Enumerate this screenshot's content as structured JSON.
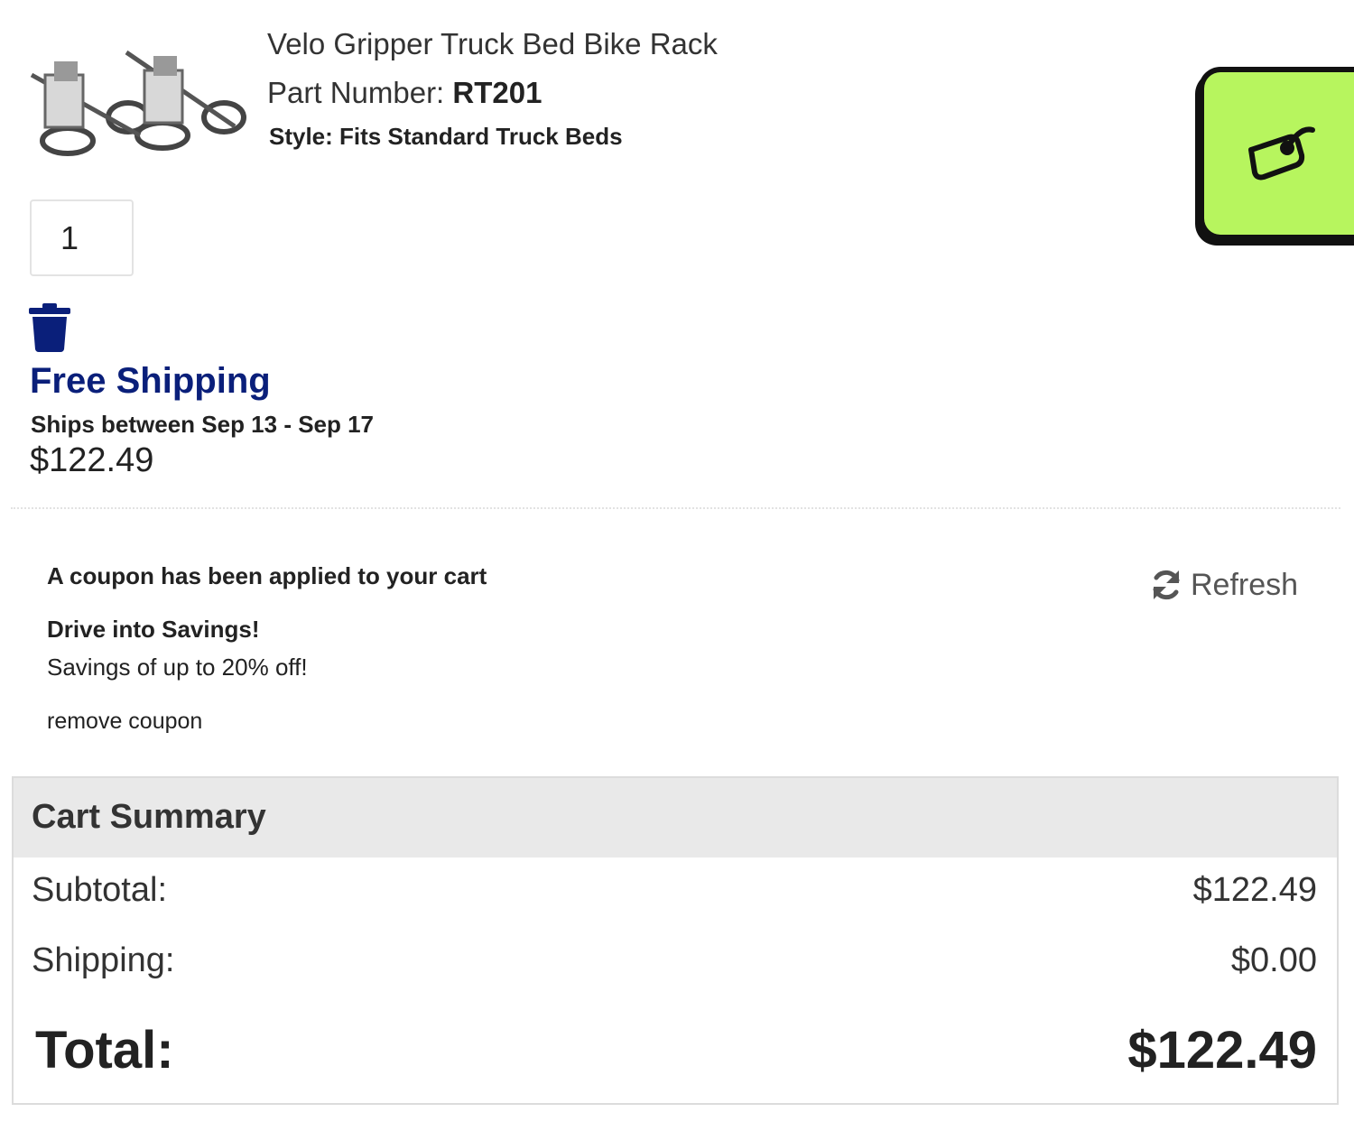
{
  "product": {
    "title": "Velo Gripper Truck Bed Bike Rack",
    "part_label": "Part Number: ",
    "part_number": "RT201",
    "style": "Style: Fits Standard Truck Beds",
    "quantity": "1",
    "shipping_label": "Free Shipping",
    "ships_between": "Ships between Sep 13 - Sep 17",
    "price": "$122.49",
    "image_icon": "bike-rack-product-image"
  },
  "coupon_tab": {
    "icon": "coupon-tag-icon",
    "color": "#b7f55e"
  },
  "coupon": {
    "applied_message": "A coupon has been applied to your cart",
    "promo_title": "Drive into Savings!",
    "promo_desc": "Savings of up to 20% off!",
    "remove_label": "remove coupon",
    "refresh_label": "Refresh",
    "refresh_icon": "refresh-icon"
  },
  "summary": {
    "title": "Cart Summary",
    "subtotal_label": "Subtotal:",
    "subtotal_value": "$122.49",
    "shipping_label": "Shipping:",
    "shipping_value": "$0.00",
    "total_label": "Total:",
    "total_value": "$122.49"
  },
  "colors": {
    "brand_blue": "#0a1f7a",
    "accent_green": "#b7f55e"
  }
}
